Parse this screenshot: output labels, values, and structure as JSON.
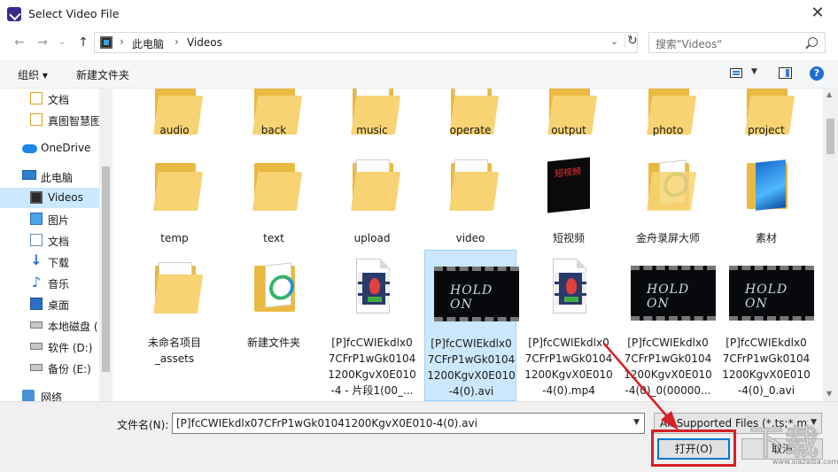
{
  "window": {
    "title": "Select Video File",
    "close_glyph": "✕"
  },
  "address": {
    "crumbs": [
      "此电脑",
      "Videos"
    ],
    "search_placeholder": "搜索\"Videos\""
  },
  "toolbar": {
    "organize": "组织 ▾",
    "new_folder": "新建文件夹",
    "help": "?"
  },
  "sidebar": {
    "items": [
      {
        "label": "文档",
        "icon": "folder-icon"
      },
      {
        "label": "真图智慧图",
        "icon": "folder-icon"
      },
      {
        "label": "OneDrive",
        "icon": "cloud-icon"
      },
      {
        "label": "此电脑",
        "icon": "computer-icon"
      },
      {
        "label": "Videos",
        "icon": "video-library-icon"
      },
      {
        "label": "图片",
        "icon": "pictures-icon"
      },
      {
        "label": "文档",
        "icon": "documents-icon"
      },
      {
        "label": "下载",
        "icon": "download-icon"
      },
      {
        "label": "音乐",
        "icon": "music-icon"
      },
      {
        "label": "桌面",
        "icon": "desktop-icon"
      },
      {
        "label": "本地磁盘 (",
        "icon": "drive-icon"
      },
      {
        "label": "软件 (D:)",
        "icon": "drive-icon"
      },
      {
        "label": "备份 (E:)",
        "icon": "drive-icon"
      },
      {
        "label": "网络",
        "icon": "network-icon"
      }
    ]
  },
  "files": {
    "row1": [
      "audio",
      "back",
      "music",
      "operate",
      "output",
      "photo",
      "project"
    ],
    "row2": [
      "temp",
      "text",
      "upload",
      "video",
      "短视频",
      "金舟录屏大师",
      "素材"
    ],
    "row3": [
      {
        "line1": "未命名项目",
        "line2": "_assets"
      },
      {
        "line1": "新建文件夹",
        "line2": ""
      },
      {
        "line1": "[P]fcCWIEkdlx0",
        "line2": "7CFrP1wGk0104",
        "line3": "1200KgvX0E010",
        "line4": "-4 - 片段1(00_..."
      },
      {
        "line1": "[P]fcCWIEkdlx0",
        "line2": "7CFrP1wGk0104",
        "line3": "1200KgvX0E010",
        "line4": "-4(0).avi"
      },
      {
        "line1": "[P]fcCWIEkdlx0",
        "line2": "7CFrP1wGk0104",
        "line3": "1200KgvX0E010",
        "line4": "-4(0).mp4"
      },
      {
        "line1": "[P]fcCWIEkdlx0",
        "line2": "7CFrP1wGk0104",
        "line3": "1200KgvX0E010",
        "line4": "-4(0)_0(00000..."
      },
      {
        "line1": "[P]fcCWIEkdlx0",
        "line2": "7CFrP1wGk0104",
        "line3": "1200KgvX0E010",
        "line4": "-4(0)_0.avi"
      }
    ],
    "thumb_text": "HOLD ON",
    "short_video_thumb_text": "短视频"
  },
  "bottom": {
    "filename_label": "文件名(N):",
    "filename_value": "[P]fcCWIEkdlx07CFrP1wGk01041200KgvX0E010-4(0).avi",
    "filter_value": "All Supported Files (*.ts;*.mts",
    "open_label": "打开(O)",
    "cancel_label": "取消"
  },
  "watermark": {
    "big": "下载",
    "small": "www.xiazaiba.com"
  },
  "colors": {
    "selection": "#cce8ff",
    "highlight_red": "#d91f26",
    "accent_blue": "#0078d7",
    "folder_yellow": "#f8d374"
  }
}
